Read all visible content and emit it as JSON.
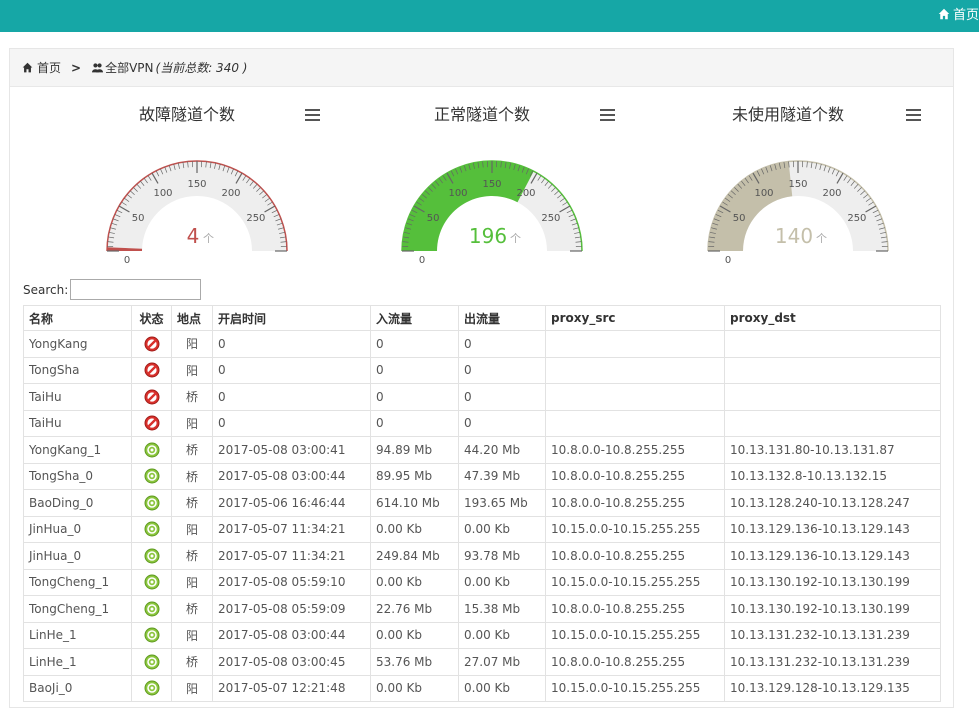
{
  "topbar": {
    "home_label": "首页"
  },
  "breadcrumb": {
    "home": "首页",
    "separator": ">",
    "current": "全部VPN",
    "count_text": "(当前总数: 340 )"
  },
  "gauges": [
    {
      "title": "故障隧道个数",
      "value": "4",
      "unit": "个",
      "numeric_value": 4,
      "max": 300,
      "color": "#c0504d",
      "ticks": [
        "0",
        "50",
        "100",
        "150",
        "200",
        "250"
      ]
    },
    {
      "title": "正常隧道个数",
      "value": "196",
      "unit": "个",
      "numeric_value": 196,
      "max": 300,
      "color": "#55bf3b",
      "ticks": [
        "0",
        "50",
        "100",
        "150",
        "200",
        "250"
      ]
    },
    {
      "title": "未使用隧道个数",
      "value": "140",
      "unit": "个",
      "numeric_value": 140,
      "max": 300,
      "color": "#c4bfaa",
      "ticks": [
        "0",
        "50",
        "100",
        "150",
        "200",
        "250"
      ]
    }
  ],
  "search": {
    "label": "Search:",
    "value": ""
  },
  "table": {
    "headers": [
      "名称",
      "状态",
      "地点",
      "开启时间",
      "入流量",
      "出流量",
      "proxy_src",
      "proxy_dst"
    ],
    "rows": [
      {
        "name": "YongKang",
        "status": "down",
        "loc": "阳",
        "time": "0",
        "in": "0",
        "out": "0",
        "src": "",
        "dst": ""
      },
      {
        "name": "TongSha",
        "status": "down",
        "loc": "阳",
        "time": "0",
        "in": "0",
        "out": "0",
        "src": "",
        "dst": ""
      },
      {
        "name": "TaiHu",
        "status": "down",
        "loc": "桥",
        "time": "0",
        "in": "0",
        "out": "0",
        "src": "",
        "dst": ""
      },
      {
        "name": "TaiHu",
        "status": "down",
        "loc": "阳",
        "time": "0",
        "in": "0",
        "out": "0",
        "src": "",
        "dst": ""
      },
      {
        "name": "YongKang_1",
        "status": "up",
        "loc": "桥",
        "time": "2017-05-08 03:00:41",
        "in": "94.89 Mb",
        "out": "44.20 Mb",
        "src": "10.8.0.0-10.8.255.255",
        "dst": "10.13.131.80-10.13.131.87"
      },
      {
        "name": "TongSha_0",
        "status": "up",
        "loc": "桥",
        "time": "2017-05-08 03:00:44",
        "in": "89.95 Mb",
        "out": "47.39 Mb",
        "src": "10.8.0.0-10.8.255.255",
        "dst": "10.13.132.8-10.13.132.15"
      },
      {
        "name": "BaoDing_0",
        "status": "up",
        "loc": "桥",
        "time": "2017-05-06 16:46:44",
        "in": "614.10 Mb",
        "out": "193.65 Mb",
        "src": "10.8.0.0-10.8.255.255",
        "dst": "10.13.128.240-10.13.128.247"
      },
      {
        "name": "JinHua_0",
        "status": "up",
        "loc": "阳",
        "time": "2017-05-07 11:34:21",
        "in": "0.00 Kb",
        "out": "0.00 Kb",
        "src": "10.15.0.0-10.15.255.255",
        "dst": "10.13.129.136-10.13.129.143"
      },
      {
        "name": "JinHua_0",
        "status": "up",
        "loc": "桥",
        "time": "2017-05-07 11:34:21",
        "in": "249.84 Mb",
        "out": "93.78 Mb",
        "src": "10.8.0.0-10.8.255.255",
        "dst": "10.13.129.136-10.13.129.143"
      },
      {
        "name": "TongCheng_1",
        "status": "up",
        "loc": "阳",
        "time": "2017-05-08 05:59:10",
        "in": "0.00 Kb",
        "out": "0.00 Kb",
        "src": "10.15.0.0-10.15.255.255",
        "dst": "10.13.130.192-10.13.130.199"
      },
      {
        "name": "TongCheng_1",
        "status": "up",
        "loc": "桥",
        "time": "2017-05-08 05:59:09",
        "in": "22.76 Mb",
        "out": "15.38 Mb",
        "src": "10.8.0.0-10.8.255.255",
        "dst": "10.13.130.192-10.13.130.199"
      },
      {
        "name": "LinHe_1",
        "status": "up",
        "loc": "阳",
        "time": "2017-05-08 03:00:44",
        "in": "0.00 Kb",
        "out": "0.00 Kb",
        "src": "10.15.0.0-10.15.255.255",
        "dst": "10.13.131.232-10.13.131.239"
      },
      {
        "name": "LinHe_1",
        "status": "up",
        "loc": "桥",
        "time": "2017-05-08 03:00:45",
        "in": "53.76 Mb",
        "out": "27.07 Mb",
        "src": "10.8.0.0-10.8.255.255",
        "dst": "10.13.131.232-10.13.131.239"
      },
      {
        "name": "BaoJi_0",
        "status": "up",
        "loc": "阳",
        "time": "2017-05-07 12:21:48",
        "in": "0.00 Kb",
        "out": "0.00 Kb",
        "src": "10.15.0.0-10.15.255.255",
        "dst": "10.13.129.128-10.13.129.135"
      }
    ]
  },
  "icons": {
    "status_down": "no-entry-icon",
    "status_up": "target-icon",
    "home": "home-icon",
    "menu": "hamburger-menu-icon",
    "group": "users-icon"
  }
}
